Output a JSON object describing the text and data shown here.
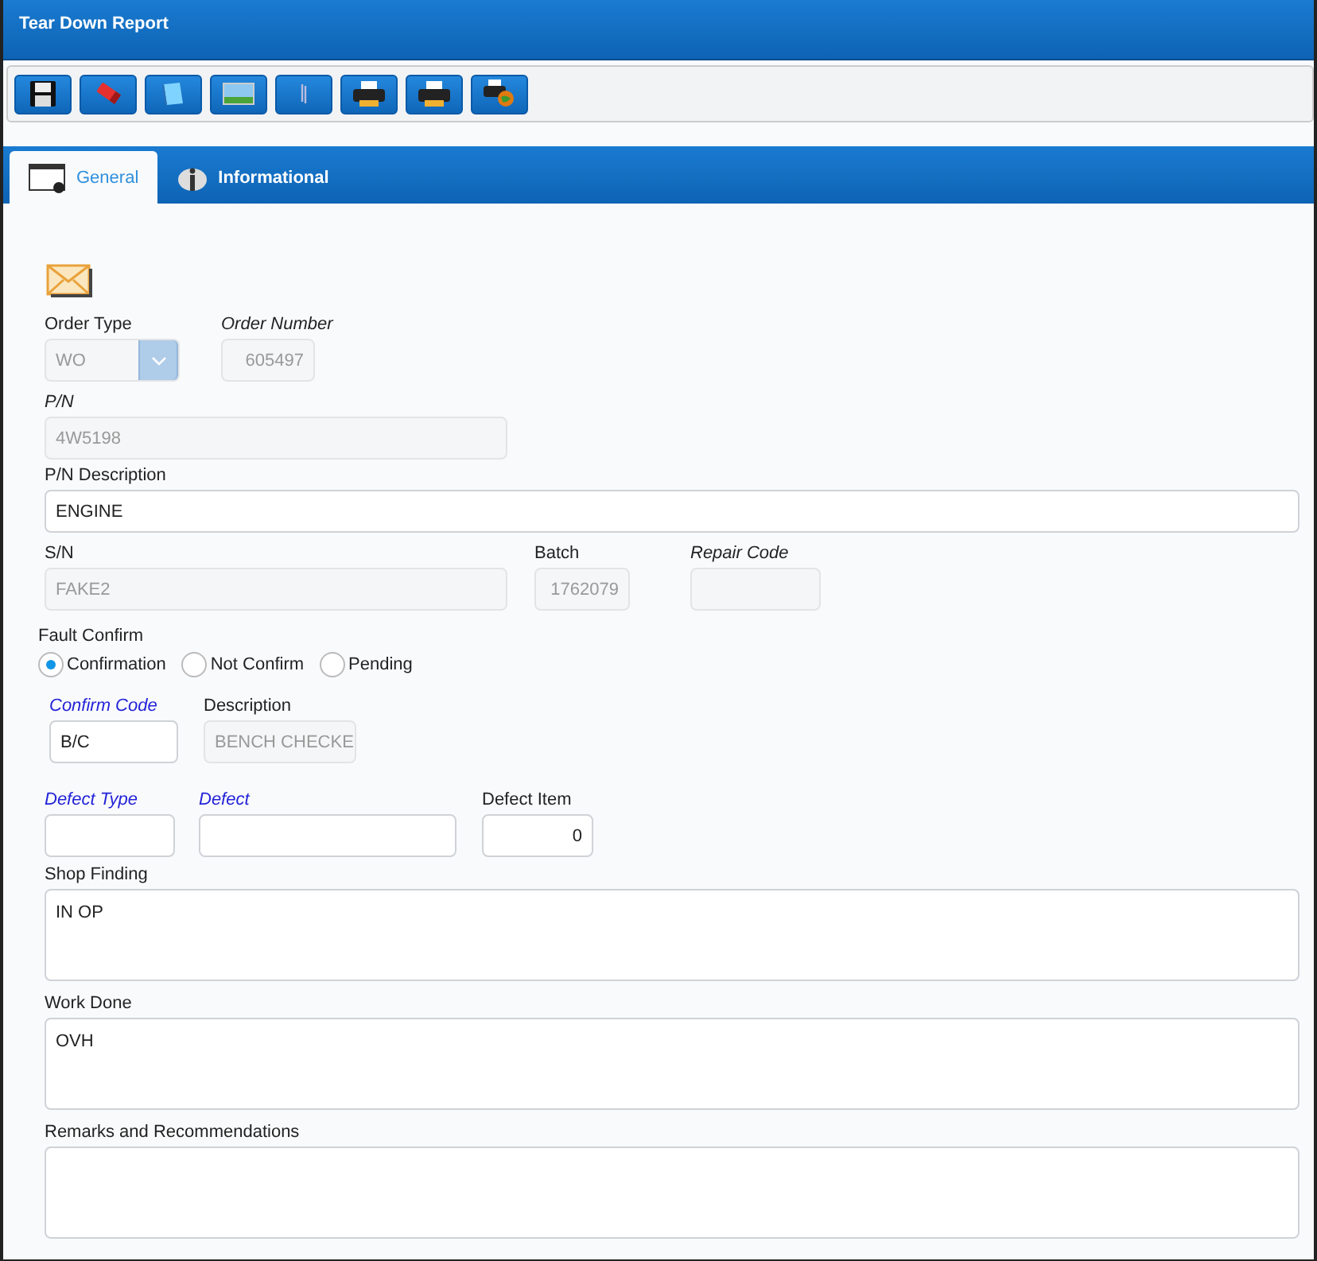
{
  "window": {
    "title": "Tear Down Report"
  },
  "toolbar": [
    {
      "kind": "save"
    },
    {
      "kind": "eraser"
    },
    {
      "kind": "book"
    },
    {
      "kind": "image"
    },
    {
      "kind": "attach"
    },
    {
      "kind": "print"
    },
    {
      "kind": "print"
    },
    {
      "kind": "print-export"
    }
  ],
  "tabs": [
    {
      "label": "General",
      "kind": "window",
      "selected": true
    },
    {
      "label": "Informational",
      "kind": "info",
      "selected": false
    }
  ],
  "fields": {
    "order_type": {
      "label": "Order Type",
      "italic_label": false,
      "lookup": false,
      "value": "WO",
      "disabled": true,
      "kind": "select"
    },
    "order_number": {
      "label": "Order Number",
      "italic_label": true,
      "lookup": false,
      "value": "605497",
      "disabled": true,
      "kind": "number"
    },
    "pn": {
      "label": "P/N",
      "italic_label": true,
      "lookup": false,
      "value": "4W5198",
      "disabled": true,
      "kind": "text"
    },
    "pn_description": {
      "label": "P/N Description",
      "italic_label": false,
      "lookup": false,
      "value": "ENGINE",
      "disabled": false,
      "kind": "text"
    },
    "sn": {
      "label": "S/N",
      "italic_label": false,
      "lookup": false,
      "value": "FAKE2",
      "disabled": true,
      "kind": "text"
    },
    "batch": {
      "label": "Batch",
      "italic_label": false,
      "lookup": false,
      "value": "1762079",
      "disabled": true,
      "kind": "number"
    },
    "repair_code": {
      "label": "Repair Code",
      "italic_label": true,
      "lookup": false,
      "disabled": true,
      "kind": "text"
    },
    "confirm_code": {
      "label": "Confirm Code",
      "italic_label": true,
      "lookup": true,
      "value": "B/C",
      "disabled": false,
      "kind": "text"
    },
    "description": {
      "label": "Description",
      "italic_label": false,
      "lookup": false,
      "value": "BENCH CHECKE",
      "disabled": true,
      "kind": "text"
    },
    "defect_type": {
      "label": "Defect Type",
      "italic_label": true,
      "lookup": true,
      "disabled": false,
      "kind": "text"
    },
    "defect": {
      "label": "Defect",
      "italic_label": true,
      "lookup": true,
      "disabled": false,
      "kind": "text"
    },
    "defect_item": {
      "label": "Defect Item",
      "italic_label": false,
      "lookup": false,
      "value": "0",
      "disabled": false,
      "kind": "number"
    },
    "shop_finding": {
      "label": "Shop Finding",
      "italic_label": false,
      "lookup": false,
      "value": "IN OP",
      "disabled": false,
      "kind": "textarea"
    },
    "work_done": {
      "label": "Work Done",
      "italic_label": false,
      "lookup": false,
      "value": "OVH",
      "disabled": false,
      "kind": "textarea"
    },
    "remarks": {
      "label": "Remarks and Recommendations",
      "italic_label": false,
      "lookup": false,
      "disabled": false,
      "kind": "textarea"
    }
  },
  "fault_confirm": {
    "label": "Fault Confirm",
    "options": [
      {
        "label": "Confirmation",
        "selected": true
      },
      {
        "label": "Not Confirm",
        "selected": false
      },
      {
        "label": "Pending",
        "selected": false
      }
    ]
  }
}
